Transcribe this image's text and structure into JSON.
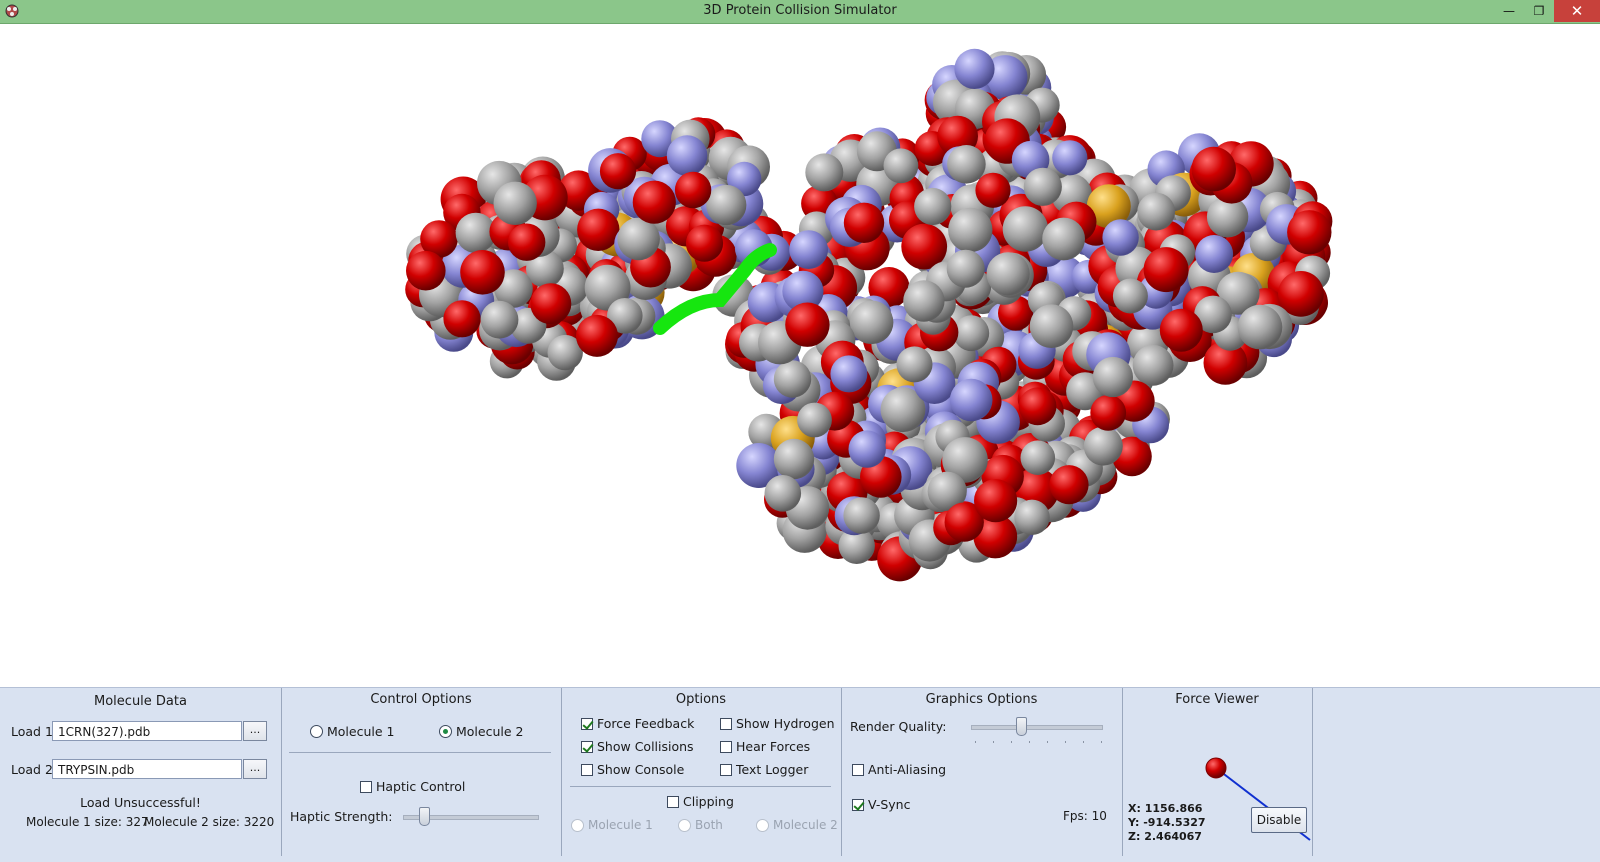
{
  "window": {
    "title": "3D Protein Collision Simulator",
    "minimize_glyph": "—",
    "restore_glyph": "❐",
    "close_glyph": "✕",
    "app_icon": "molecule-icon"
  },
  "molecule_data": {
    "title": "Molecule Data",
    "load1_label": "Load 1:",
    "load1_value": "1CRN(327).pdb",
    "load2_label": "Load 2:",
    "load2_value": "TRYPSIN.pdb",
    "browse_label": "...",
    "status": "Load Unsuccessful!",
    "mol1_size": "Molecule 1 size: 327",
    "mol2_size": "Molecule 2 size: 3220"
  },
  "control_options": {
    "title": "Control Options",
    "radio_mol1": "Molecule 1",
    "radio_mol2": "Molecule 2",
    "selected": "Molecule 2",
    "haptic_control": "Haptic Control",
    "haptic_control_checked": false,
    "haptic_strength_label": "Haptic Strength:",
    "haptic_strength_level": 0.15
  },
  "options": {
    "title": "Options",
    "force_feedback": "Force Feedback",
    "force_feedback_checked": true,
    "show_collisions": "Show Collisions",
    "show_collisions_checked": true,
    "show_console": "Show Console",
    "show_console_checked": false,
    "show_hydrogen": "Show Hydrogen",
    "show_hydrogen_checked": false,
    "hear_forces": "Hear Forces",
    "hear_forces_checked": false,
    "text_logger": "Text Logger",
    "text_logger_checked": false,
    "clipping": "Clipping",
    "clipping_checked": false,
    "clip_mol1": "Molecule 1",
    "clip_both": "Both",
    "clip_mol2": "Molecule 2"
  },
  "graphics_options": {
    "title": "Graphics Options",
    "render_quality_label": "Render Quality:",
    "render_quality_level": 0.36,
    "anti_aliasing": "Anti-Aliasing",
    "anti_aliasing_checked": false,
    "vsync": "V-Sync",
    "vsync_checked": true,
    "fps": "Fps: 10"
  },
  "force_viewer": {
    "title": "Force Viewer",
    "x": "X: 1156.866",
    "y": "Y: -914.5327",
    "z": "Z: 2.464067",
    "disable_label": "Disable"
  },
  "colors": {
    "carbon": "#9a9a9a",
    "oxygen": "#d00000",
    "nitrogen": "#8a8ad8",
    "sulfur": "#d8a21e",
    "collision": "#16e60f"
  }
}
